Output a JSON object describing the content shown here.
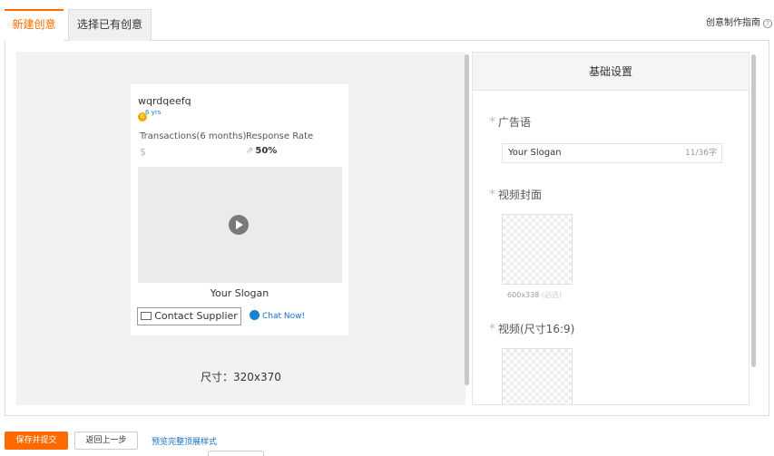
{
  "tabs": [
    {
      "label": "新建创意",
      "active": true
    },
    {
      "label": "选择已有创意",
      "active": false
    }
  ],
  "guide": {
    "label": "创意制作指南",
    "icon": "help-icon"
  },
  "preview": {
    "company": "wqrdqeefq",
    "gold_tag": "6 yrs",
    "transactions_label": "Transactions(6 months)",
    "transactions_value": "$",
    "response_label": "Response Rate",
    "response_value": "50%",
    "slogan": "Your Slogan",
    "contact_label": "Contact Supplier",
    "chat_label": "Chat Now!",
    "size_text": "尺寸：320x370"
  },
  "settings": {
    "title": "基础设置",
    "slogan_label": "广告语",
    "slogan_value": "Your Slogan",
    "slogan_counter": "11/36字",
    "cover_label": "视频封面",
    "cover_hint_size": "600x338",
    "cover_hint_req": "(必选)",
    "video_label": "视频(尺寸16:9)"
  },
  "actions": {
    "submit_label": "保存并提交",
    "back_label": "返回上一步",
    "preview_link": "预览完整顶展样式"
  },
  "colors": {
    "accent": "#ff6a00",
    "link": "#1a6fc9"
  }
}
